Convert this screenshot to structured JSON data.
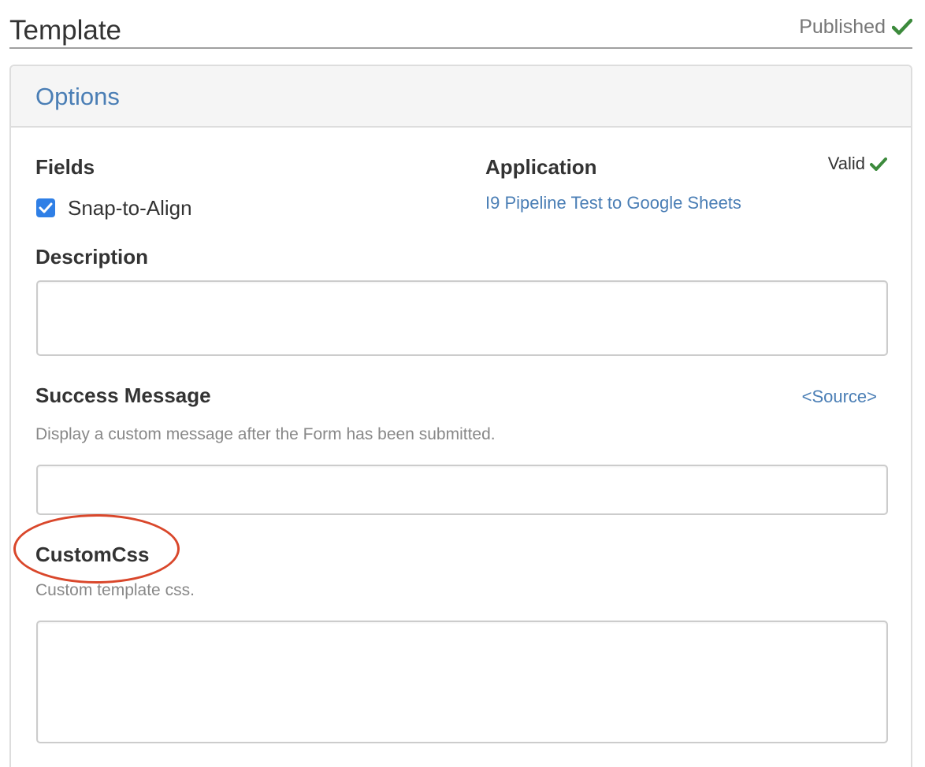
{
  "header": {
    "title": "Template",
    "status": "Published",
    "status_icon": "check-icon",
    "status_icon_color": "#3c8a3c"
  },
  "panel": {
    "title": "Options",
    "fields": {
      "label": "Fields",
      "snap_to_align": {
        "label": "Snap-to-Align",
        "checked": true
      }
    },
    "application": {
      "label": "Application",
      "link": "I9 Pipeline Test to Google Sheets",
      "validity": "Valid",
      "validity_icon": "check-icon"
    },
    "description": {
      "label": "Description",
      "value": ""
    },
    "success_message": {
      "label": "Success Message",
      "source_link": "<Source>",
      "help": "Display a custom message after the Form has been submitted.",
      "value": ""
    },
    "custom_css": {
      "label": "CustomCss",
      "help": "Custom template css.",
      "value": ""
    }
  },
  "colors": {
    "link": "#4a7eb5",
    "checkbox": "#2f7fe6",
    "annotation": "#d9472b",
    "valid_check": "#3c8a3c"
  }
}
